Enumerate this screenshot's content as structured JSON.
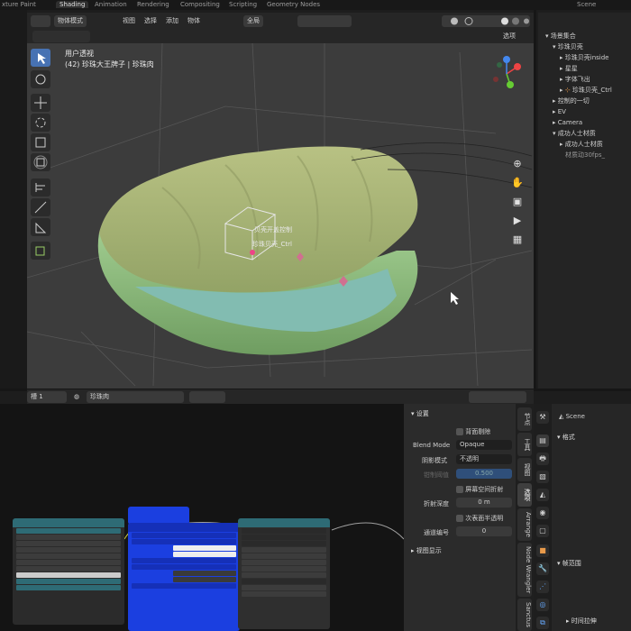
{
  "workspace_tabs": [
    "xture Paint",
    "Shading",
    "Animation",
    "Rendering",
    "Compositing",
    "Scripting",
    "Geometry Nodes",
    "Scene"
  ],
  "viewport_header": {
    "mode": "物体模式",
    "menus": [
      "视图",
      "选择",
      "添加",
      "物体"
    ],
    "transform_orientation": "全局",
    "options_label": "选项"
  },
  "viewport": {
    "view_name": "用户透视",
    "object_info": "(42) 珍珠大王牌子 | 珍珠肉",
    "labels": {
      "control": "贝壳开盖控制",
      "ctrl_name": "珍珠贝壳_Ctrl"
    },
    "nav_icons": [
      "zoom-icon",
      "hand-icon",
      "camera-icon",
      "video-icon",
      "grid-icon"
    ]
  },
  "outliner": {
    "items": [
      {
        "label": "场景集合"
      },
      {
        "label": "珍珠贝壳"
      },
      {
        "label": "珍珠贝壳inside"
      },
      {
        "label": "星星"
      },
      {
        "label": "字体飞出"
      },
      {
        "label": "珍珠贝壳_Ctrl"
      },
      {
        "label": "控制的一切"
      },
      {
        "label": "EV"
      },
      {
        "label": "Camera"
      },
      {
        "label": "成功人士材质"
      },
      {
        "label": "成功人士材质"
      },
      {
        "label": "材质动30fps_"
      }
    ]
  },
  "node_editor_header": {
    "slot": "槽 1",
    "material_name": "珍珠肉"
  },
  "node_panel": {
    "section_title": "设置",
    "backface_culling": "背面剔除",
    "blend_mode_label": "Blend Mode",
    "blend_mode_value": "Opaque",
    "shadow_mode_label": "阴影模式",
    "shadow_mode_value": "不透明",
    "clip_threshold_label": "钳制阈值",
    "clip_threshold_value": "0.500",
    "screen_refraction": "屏幕空间折射",
    "refraction_depth_label": "折射深度",
    "refraction_depth_value": "0 m",
    "subsurface_translucency": "次表面半透明",
    "pass_index_label": "通道编号",
    "pass_index_value": "0",
    "viewport_display": "视图显示"
  },
  "vertical_tabs": [
    "节点",
    "工具",
    "视图",
    "选项",
    "Arrange",
    "Node Wrangler",
    "Sanctus"
  ],
  "properties": {
    "scene_label": "Scene",
    "format_section": "格式",
    "frame_range_section": "帧范围",
    "time_stretch_section": "时间拉伸"
  },
  "colors": {
    "accent": "#4772b3",
    "shell_top": "#a9b47a",
    "shell_bottom": "#8fb77c",
    "pearl_meat": "#7fb9a8",
    "node_blue": "#1b3fe0",
    "node_teal": "#2e6b75"
  }
}
